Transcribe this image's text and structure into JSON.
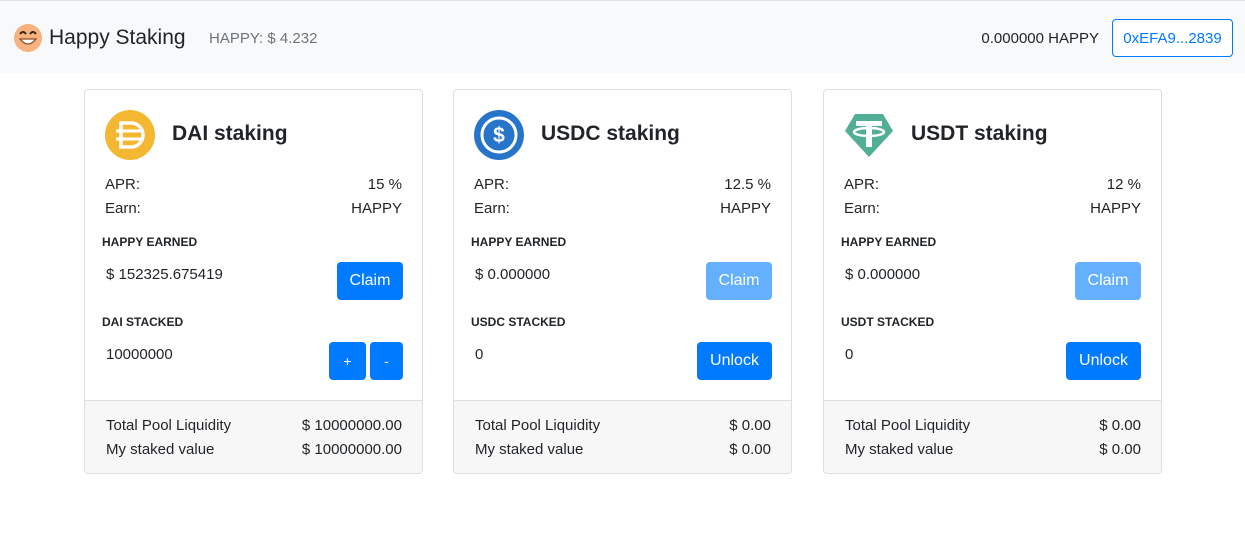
{
  "header": {
    "brand_name": "Happy Staking",
    "price": "HAPPY: $ 4.232",
    "balance": "0.000000 HAPPY",
    "wallet": "0xEFA9...2839"
  },
  "cards": [
    {
      "title": "DAI staking",
      "icon": "dai-icon",
      "apr_label": "APR:",
      "apr_value": "15 %",
      "earn_label": "Earn:",
      "earn_value": "HAPPY",
      "earned_label": "HAPPY EARNED",
      "earned_value": "$ 152325.675419",
      "claim_label": "Claim",
      "stacked_label": "DAI STACKED",
      "stacked_value": "10000000",
      "plus_label": "+",
      "minus_label": "-",
      "liquidity_label": "Total Pool Liquidity",
      "liquidity_value": "$ 10000000.00",
      "staked_label": "My staked value",
      "staked_value": "$ 10000000.00"
    },
    {
      "title": "USDC staking",
      "icon": "usdc-icon",
      "apr_label": "APR:",
      "apr_value": "12.5 %",
      "earn_label": "Earn:",
      "earn_value": "HAPPY",
      "earned_label": "HAPPY EARNED",
      "earned_value": "$ 0.000000",
      "claim_label": "Claim",
      "stacked_label": "USDC STACKED",
      "stacked_value": "0",
      "unlock_label": "Unlock",
      "liquidity_label": "Total Pool Liquidity",
      "liquidity_value": "$ 0.00",
      "staked_label": "My staked value",
      "staked_value": "$ 0.00"
    },
    {
      "title": "USDT staking",
      "icon": "usdt-icon",
      "apr_label": "APR:",
      "apr_value": "12 %",
      "earn_label": "Earn:",
      "earn_value": "HAPPY",
      "earned_label": "HAPPY EARNED",
      "earned_value": "$ 0.000000",
      "claim_label": "Claim",
      "stacked_label": "USDT STACKED",
      "stacked_value": "0",
      "unlock_label": "Unlock",
      "liquidity_label": "Total Pool Liquidity",
      "liquidity_value": "$ 0.00",
      "staked_label": "My staked value",
      "staked_value": "$ 0.00"
    }
  ],
  "colors": {
    "primary": "#007bff",
    "primary_disabled": "#64b0ff",
    "dai": "#f4b731",
    "usdc": "#2775ca",
    "usdt": "#50af95",
    "navbar_bg": "#f8f9fa"
  }
}
